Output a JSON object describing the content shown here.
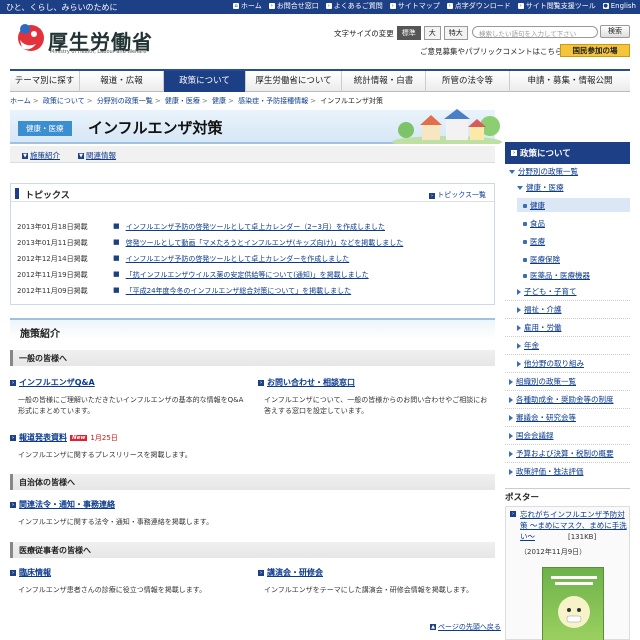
{
  "topbar": {
    "tagline": "ひと、くらし、みらいのために",
    "links": [
      "ホーム",
      "お問合せ窓口",
      "よくあるご質問",
      "サイトマップ",
      "点字ダウンロード",
      "サイト閲覧支援ツール",
      "English"
    ]
  },
  "header": {
    "logo_name": "厚生労働省",
    "logo_english": "Ministry of Health, Labour and Welfare",
    "fontsize_label": "文字サイズの変更",
    "fontsize_options": [
      "標準",
      "大",
      "特大"
    ],
    "search_placeholder": "検索したい語句を入力して下さい",
    "search_button": "検索",
    "opinion_link": "ご意見募集やパブリックコメントはこちら",
    "kokumin_button": "国民参加の場"
  },
  "nav": {
    "tabs": [
      "テーマ別に探す",
      "報道・広報",
      "政策について",
      "厚生労働省について",
      "統計情報・白書",
      "所管の法令等",
      "申請・募集・情報公開"
    ]
  },
  "breadcrumb": [
    "ホーム",
    "政策について",
    "分野別の政策一覧",
    "健康・医療",
    "健康",
    "感染症・予防接種情報",
    "インフルエンザ対策"
  ],
  "page": {
    "category": "健康・医療",
    "title": "インフルエンザ対策"
  },
  "subnav": [
    "施策紹介",
    "関連情報"
  ],
  "topics": {
    "heading": "トピックス",
    "more": "トピックス一覧",
    "items": [
      {
        "date": "2013年01月18日掲載",
        "text": "インフルエンザ予防の啓発ツールとして卓上カレンダー（2~3月）を作成しました"
      },
      {
        "date": "2013年01月11日掲載",
        "text": "啓発ツールとして動画「マメたろうとインフルエンザ(キッズ向け)」などを掲載しました"
      },
      {
        "date": "2012年12月14日掲載",
        "text": "インフルエンザ予防の啓発ツールとして卓上カレンダーを作成しました"
      },
      {
        "date": "2012年11月19日掲載",
        "text": "「抗インフルエンザウイルス薬の安定供給等について(通知)」を掲載しました"
      },
      {
        "date": "2012年11月09日掲載",
        "text": "「平成24年度今冬のインフルエンザ総合対策について」を掲載しました"
      }
    ]
  },
  "policy": {
    "heading": "施策紹介",
    "groups": [
      {
        "heading": "一般の皆様へ",
        "items": [
          {
            "title": "インフルエンザQ&A",
            "desc": "一般の皆様にご理解いただきたいインフルエンザの基本的な情報をQ&A形式にまとめています。"
          },
          {
            "title": "お問い合わせ・相談窓口",
            "desc": "インフルエンザについて、一般の皆様からのお問い合わせやご相談にお答えする窓口を設定しています。"
          },
          {
            "title": "報道発表資料",
            "badge": "New",
            "date": "1月25日",
            "desc": "インフルエンザに関するプレスリリースを掲載します。"
          }
        ]
      },
      {
        "heading": "自治体の皆様へ",
        "items": [
          {
            "title": "関連法令・通知・事務連絡",
            "desc": "インフルエンザに関する法令・通知・事務連絡を掲載します。"
          }
        ]
      },
      {
        "heading": "医療従事者の皆様へ",
        "items": [
          {
            "title": "臨床情報",
            "desc": "インフルエンザ患者さんの診療に役立つ情報を掲載します。"
          },
          {
            "title": "講演会・研修会",
            "desc": "インフルエンザをテーマにした講演会・研修会情報を掲載します。"
          }
        ]
      }
    ],
    "pagetop": "ページの先頭へ戻る"
  },
  "sidebar": {
    "heading": "政策について",
    "items": [
      "分野別の政策一覧",
      "健康・医療",
      "健康",
      "食品",
      "医療",
      "医療保険",
      "医薬品・医療機器",
      "子ども・子育て",
      "福祉・介護",
      "雇用・労働",
      "年金",
      "他分野の取り組み",
      "組織別の政策一覧",
      "各種助成金・奨励金等の制度",
      "審議会・研究会等",
      "国会会議録",
      "予算および決算・税制の概要",
      "政策評価・独法評価"
    ]
  },
  "poster": {
    "heading": "ポスター",
    "title": "忘れがちインフルエンザ予防対策 〜まめにマスク、まめに手洗い〜",
    "size": "[131KB]",
    "date": "（2012年11月9日）"
  },
  "colors": {
    "primary": "#1d3f86",
    "link": "#0b3a8e",
    "accent_yellow": "#f4c43c",
    "new_badge": "#dd2233"
  }
}
